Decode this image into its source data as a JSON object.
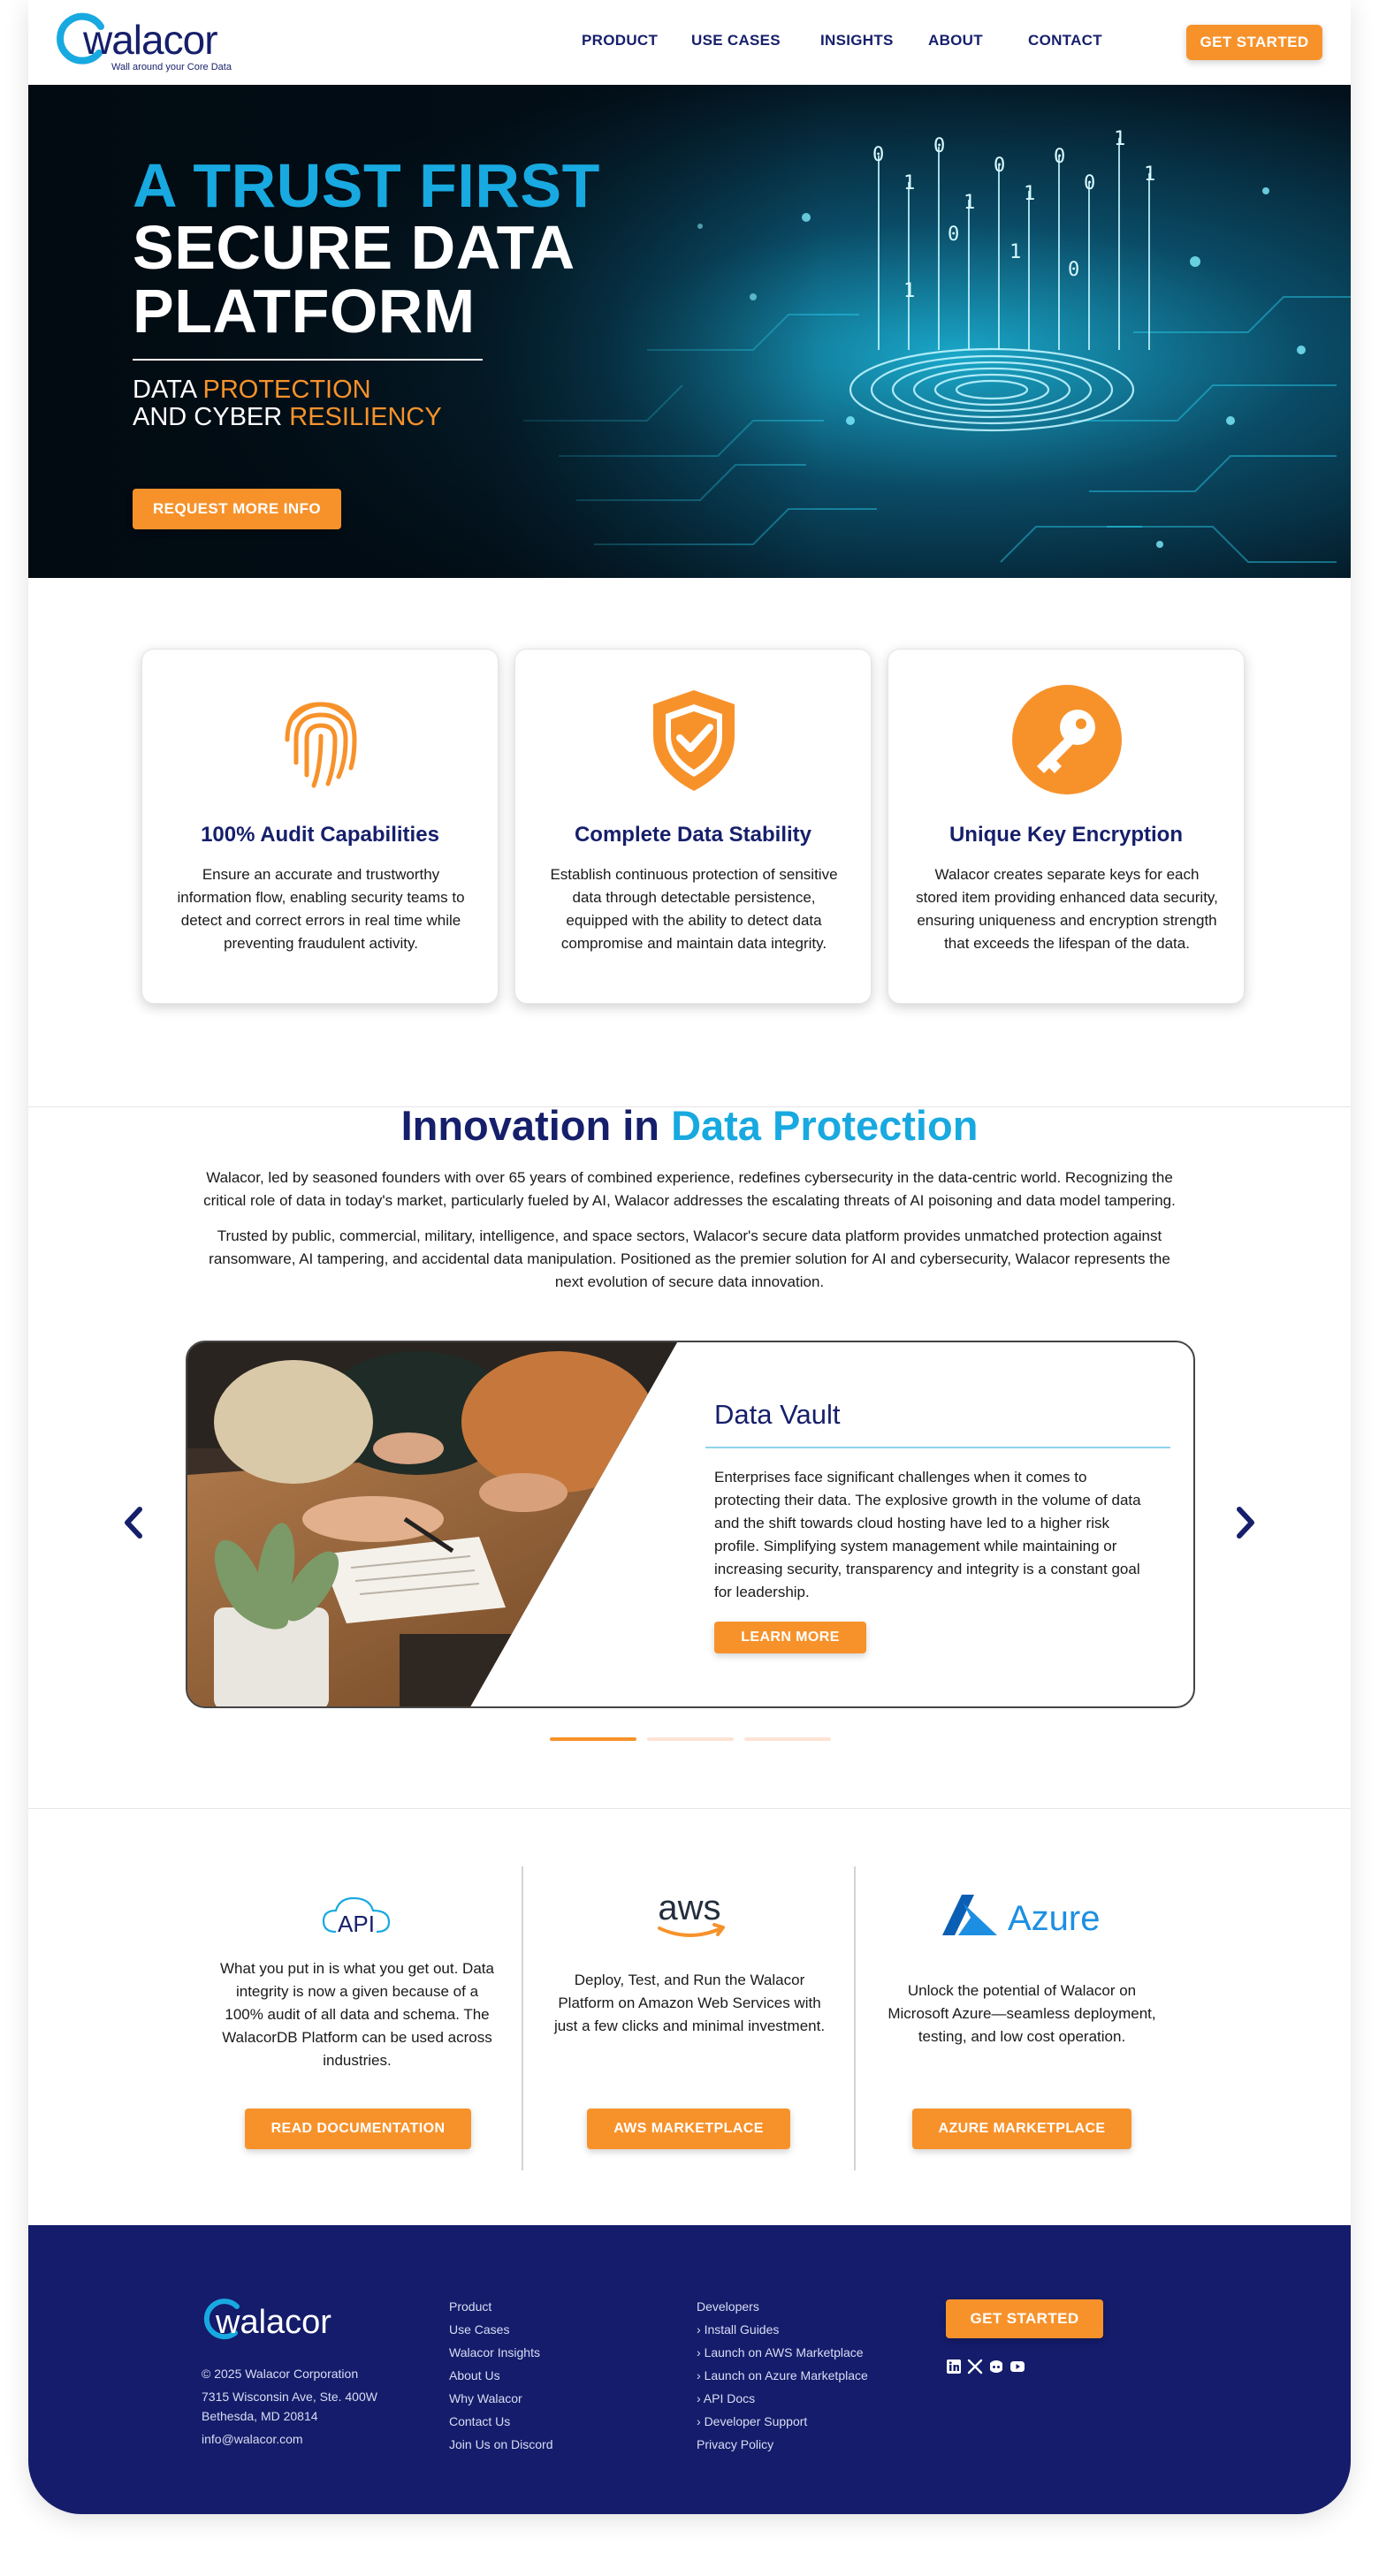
{
  "brand": {
    "name": "walacor",
    "tagline": "Wall around your Core Data",
    "colors": {
      "navy": "#161f6b",
      "cyan": "#18a9e0",
      "orange": "#f7922b",
      "footer": "#141c6b"
    }
  },
  "nav": {
    "items": [
      "PRODUCT",
      "USE CASES",
      "INSIGHTS",
      "ABOUT",
      "CONTACT"
    ],
    "cta": "GET STARTED"
  },
  "hero": {
    "title_line1": "A TRUST FIRST",
    "title_line2": "SECURE DATA PLATFORM",
    "sub1_a": "DATA ",
    "sub1_b": "PROTECTION",
    "sub2_a": "AND CYBER ",
    "sub2_b": "RESILIENCY",
    "cta": "REQUEST MORE INFO"
  },
  "features": [
    {
      "icon": "fingerprint-icon",
      "title": "100% Audit Capabilities",
      "text": "Ensure an accurate and trustworthy information flow, enabling security teams to detect and correct errors in real time while preventing fraudulent activity."
    },
    {
      "icon": "shield-check-icon",
      "title": "Complete Data Stability",
      "text": "Establish continuous protection of sensitive data through detectable persistence, equipped with the ability to detect data compromise and maintain data integrity."
    },
    {
      "icon": "key-icon",
      "title": "Unique Key Encryption",
      "text": "Walacor creates separate keys for each stored item providing enhanced data security, ensuring uniqueness and encryption strength that exceeds the lifespan of the data."
    }
  ],
  "innovation": {
    "title_a": "Innovation in ",
    "title_b": "Data Protection",
    "p1": "Walacor, led by seasoned founders with over 65 years of combined experience, redefines cybersecurity in the data-centric world. Recognizing the critical role of data in today's market, particularly fueled by AI, Walacor addresses the escalating threats of AI poisoning and data model tampering.",
    "p2": "Trusted by public, commercial, military, intelligence, and space sectors, Walacor's secure data platform provides unmatched protection against ransomware, AI tampering, and accidental data manipulation. Positioned as the premier solution for AI and cybersecurity, Walacor represents the next evolution of secure data innovation."
  },
  "slider": {
    "title": "Data Vault",
    "text": "Enterprises face significant challenges when it comes to protecting their data. The explosive growth in the volume of data and the shift towards cloud hosting have led to a higher risk profile. Simplifying system management while maintaining or increasing security, transparency and integrity is a constant goal for leadership.",
    "cta": "LEARN MORE",
    "active_index": 0,
    "slide_count": 3
  },
  "integrations": [
    {
      "logo": "API",
      "text": "What you put in is what you get out. Data integrity is now a given because of a 100% audit of all data and schema. The WalacorDB Platform can be used across industries.",
      "cta": "READ DOCUMENTATION"
    },
    {
      "logo": "aws",
      "text": "Deploy, Test, and Run the Walacor Platform on Amazon Web Services with just a few clicks and minimal investment.",
      "cta": "AWS MARKETPLACE"
    },
    {
      "logo": "Azure",
      "text": "Unlock the potential of Walacor on Microsoft Azure—seamless deployment, testing, and low cost operation.",
      "cta": "AZURE MARKETPLACE"
    }
  ],
  "footer": {
    "copyright": "© 2025 Walacor Corporation",
    "address1": "7315 Wisconsin Ave, Ste. 400W",
    "address2": "Bethesda, MD 20814",
    "email": "info@walacor.com",
    "col1": [
      "Product",
      "Use Cases",
      "Walacor Insights",
      "About Us",
      "Why Walacor",
      "Contact Us",
      "Join Us on Discord"
    ],
    "col2_head": "Developers",
    "col2": [
      "Install Guides",
      "Launch on AWS Marketplace",
      "Launch on Azure Marketplace",
      "API Docs",
      "Developer Support"
    ],
    "col2_tail": "Privacy Policy",
    "cta": "GET STARTED",
    "social": [
      "linkedin-icon",
      "x-icon",
      "discord-icon",
      "youtube-icon"
    ]
  }
}
